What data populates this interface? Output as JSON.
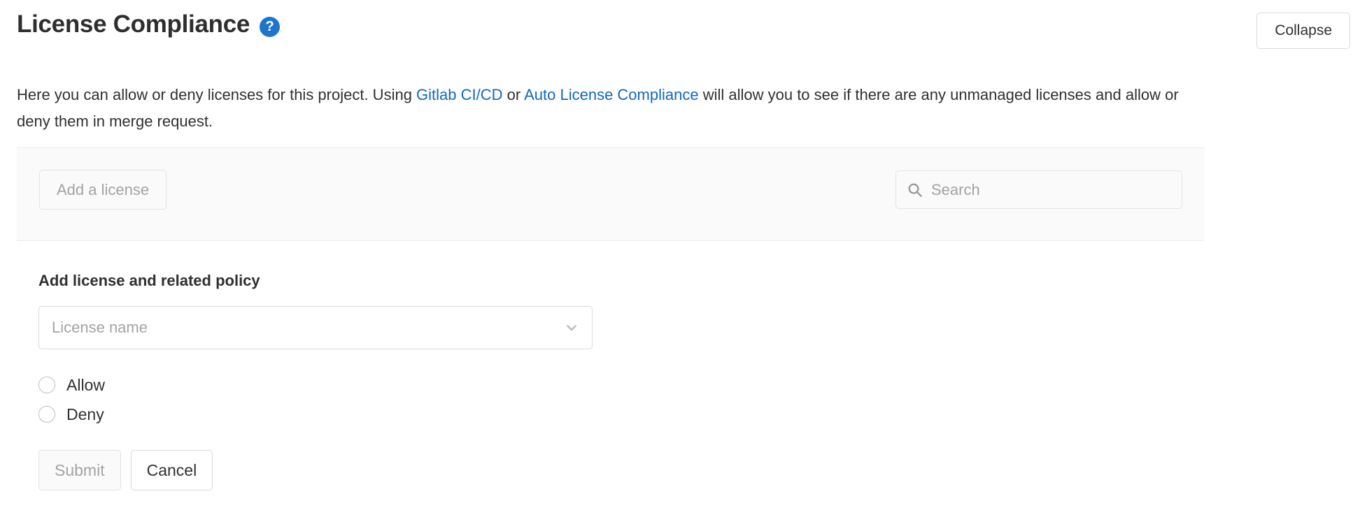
{
  "header": {
    "title": "License Compliance",
    "help_icon": "help-circle-icon",
    "help_glyph": "?",
    "collapse_label": "Collapse",
    "accent_color": "#1f75cb",
    "link_color": "#1068bf"
  },
  "description": {
    "part1": "Here you can allow or deny licenses for this project. Using ",
    "link1": "Gitlab CI/CD",
    "part2": " or ",
    "link2": "Auto License Compliance",
    "part3": " will allow you to see if there are any unmanaged licenses and allow or deny them in merge request."
  },
  "toolbar": {
    "add_license_label": "Add a license",
    "search_placeholder": "Search",
    "search_value": "",
    "search_icon": "search-icon"
  },
  "form": {
    "heading": "Add license and related policy",
    "license_select": {
      "placeholder": "License name",
      "value": "License name",
      "chevron_icon": "chevron-down-icon"
    },
    "radios": [
      {
        "label": "Allow",
        "selected": false
      },
      {
        "label": "Deny",
        "selected": false
      }
    ],
    "submit_label": "Submit",
    "cancel_label": "Cancel"
  }
}
